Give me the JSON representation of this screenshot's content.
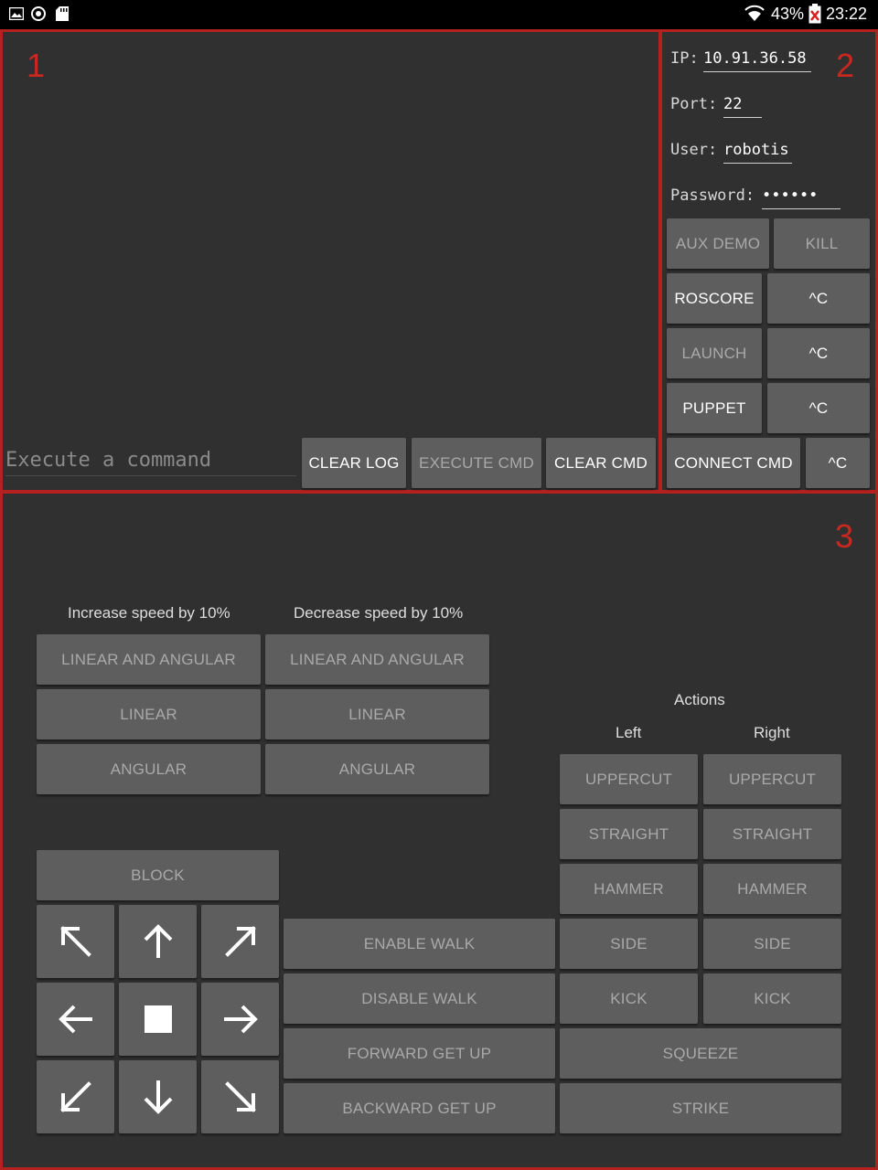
{
  "status_bar": {
    "icons": [
      "image-icon",
      "sync-icon",
      "sd-card-icon",
      "wifi-icon",
      "battery-icon"
    ],
    "battery": "43%",
    "time": "23:22"
  },
  "panel1": {
    "number": "1",
    "command_placeholder": "Execute a command",
    "buttons": {
      "clear_log": "CLEAR LOG",
      "execute_cmd": "EXECUTE CMD",
      "clear_cmd": "CLEAR CMD"
    }
  },
  "panel2": {
    "number": "2",
    "ip_label": "IP:",
    "ip_value": "10.91.36.58",
    "port_label": "Port:",
    "port_value": "22",
    "user_label": "User:",
    "user_value": "robotis",
    "password_label": "Password:",
    "password_value": "••••••",
    "buttons": {
      "aux_demo": "AUX DEMO",
      "kill": "KILL",
      "roscore": "ROSCORE",
      "roscore_ctrl_c": "^C",
      "launch": "LAUNCH",
      "launch_ctrl_c": "^C",
      "puppet": "PUPPET",
      "puppet_ctrl_c": "^C",
      "connect_cmd": "CONNECT CMD",
      "connect_ctrl_c": "^C"
    }
  },
  "panel3": {
    "number": "3",
    "increase_label": "Increase speed by 10%",
    "decrease_label": "Decrease speed by 10%",
    "increase": {
      "linear_and_angular": "LINEAR AND ANGULAR",
      "linear": "LINEAR",
      "angular": "ANGULAR"
    },
    "decrease": {
      "linear_and_angular": "LINEAR AND ANGULAR",
      "linear": "LINEAR",
      "angular": "ANGULAR"
    },
    "block": "BLOCK",
    "walk": {
      "enable": "ENABLE WALK",
      "disable": "DISABLE WALK",
      "forward_get_up": "FORWARD GET UP",
      "backward_get_up": "BACKWARD GET UP"
    },
    "actions_label": "Actions",
    "left_label": "Left",
    "right_label": "Right",
    "left": {
      "uppercut": "UPPERCUT",
      "straight": "STRAIGHT",
      "hammer": "HAMMER",
      "side": "SIDE",
      "kick": "KICK"
    },
    "right": {
      "uppercut": "UPPERCUT",
      "straight": "STRAIGHT",
      "hammer": "HAMMER",
      "side": "SIDE",
      "kick": "KICK"
    },
    "squeeze": "SQUEEZE",
    "strike": "STRIKE"
  },
  "colors": {
    "panel_bg": "#303030",
    "border": "#b3221f",
    "button": "#5e5e5e",
    "number": "#c8281f"
  }
}
